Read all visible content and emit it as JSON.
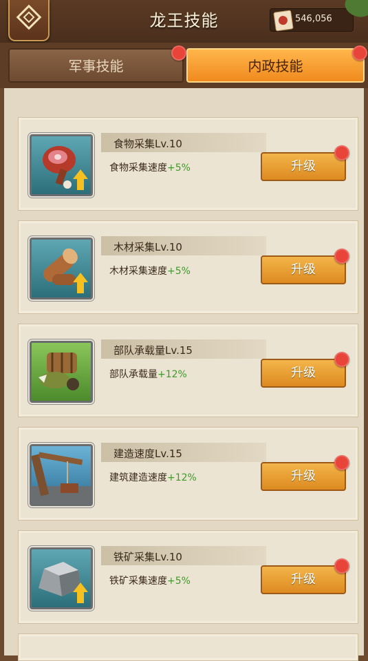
{
  "header": {
    "title": "龙王技能",
    "currency_amount": "546,056"
  },
  "tabs": [
    {
      "label": "军事技能",
      "active": false,
      "has_badge": true
    },
    {
      "label": "内政技能",
      "active": true,
      "has_badge": true
    }
  ],
  "skills": [
    {
      "icon": "meat-icon",
      "name": "食物采集Lv.10",
      "desc": "食物采集速度",
      "bonus": "+5%",
      "button": "升级"
    },
    {
      "icon": "wood-log-icon",
      "name": "木材采集Lv.10",
      "desc": "木材采集速度",
      "bonus": "+5%",
      "button": "升级"
    },
    {
      "icon": "war-cart-icon",
      "name": "部队承载量Lv.15",
      "desc": "部队承载量",
      "bonus": "+12%",
      "button": "升级"
    },
    {
      "icon": "construction-icon",
      "name": "建造速度Lv.15",
      "desc": "建筑建造速度",
      "bonus": "+12%",
      "button": "升级"
    },
    {
      "icon": "iron-ore-icon",
      "name": "铁矿采集Lv.10",
      "desc": "铁矿采集速度",
      "bonus": "+5%",
      "button": "升级"
    }
  ],
  "colors": {
    "active_tab": "#f08a1e",
    "bonus_text": "#3c9a2a",
    "badge": "#e8443a"
  }
}
